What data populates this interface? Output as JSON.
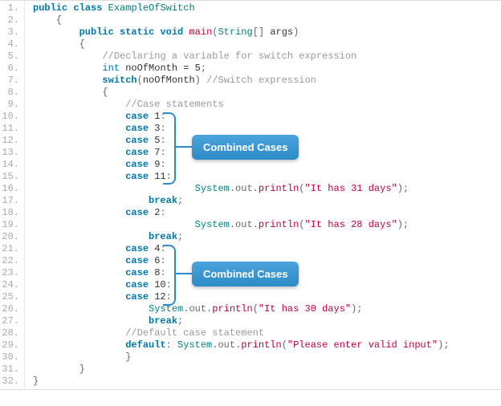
{
  "lines": [
    {
      "n": "1.",
      "tokens": [
        {
          "t": "public",
          "c": "kw"
        },
        {
          "t": " "
        },
        {
          "t": "class",
          "c": "kw"
        },
        {
          "t": " "
        },
        {
          "t": "ExampleOfSwitch",
          "c": "cls"
        }
      ],
      "indent": 0
    },
    {
      "n": "2.",
      "tokens": [
        {
          "t": "{",
          "c": "pun"
        }
      ],
      "indent": 1
    },
    {
      "n": "3.",
      "tokens": [
        {
          "t": "public",
          "c": "kw"
        },
        {
          "t": " "
        },
        {
          "t": "static",
          "c": "kw"
        },
        {
          "t": " "
        },
        {
          "t": "void",
          "c": "kw"
        },
        {
          "t": " "
        },
        {
          "t": "main",
          "c": "fn"
        },
        {
          "t": "(",
          "c": "pun"
        },
        {
          "t": "String",
          "c": "cls"
        },
        {
          "t": "[] ",
          "c": "pun"
        },
        {
          "t": "args",
          "c": "var"
        },
        {
          "t": ")",
          "c": "pun"
        }
      ],
      "indent": 2
    },
    {
      "n": "4.",
      "tokens": [
        {
          "t": "{",
          "c": "pun"
        }
      ],
      "indent": 2
    },
    {
      "n": "5.",
      "tokens": [
        {
          "t": "//Declaring a variable for switch expression",
          "c": "cmt"
        }
      ],
      "indent": 3
    },
    {
      "n": "6.",
      "tokens": [
        {
          "t": "int",
          "c": "type"
        },
        {
          "t": " noOfMonth = "
        },
        {
          "t": "5",
          "c": "num"
        },
        {
          "t": ";",
          "c": "pun"
        }
      ],
      "indent": 3
    },
    {
      "n": "7.",
      "tokens": [
        {
          "t": "switch",
          "c": "kw"
        },
        {
          "t": "(",
          "c": "pun"
        },
        {
          "t": "noOfMonth",
          "c": "var"
        },
        {
          "t": ")",
          "c": "pun"
        },
        {
          "t": " "
        },
        {
          "t": "//Switch expression",
          "c": "cmt"
        }
      ],
      "indent": 3
    },
    {
      "n": "8.",
      "tokens": [
        {
          "t": "{",
          "c": "pun"
        }
      ],
      "indent": 3
    },
    {
      "n": "9.",
      "tokens": [
        {
          "t": "//Case statements",
          "c": "cmt"
        }
      ],
      "indent": 4
    },
    {
      "n": "10.",
      "tokens": [
        {
          "t": "case",
          "c": "kw"
        },
        {
          "t": " "
        },
        {
          "t": "1",
          "c": "num"
        },
        {
          "t": ":",
          "c": "pun"
        }
      ],
      "indent": 4
    },
    {
      "n": "11.",
      "tokens": [
        {
          "t": "case",
          "c": "kw"
        },
        {
          "t": " "
        },
        {
          "t": "3",
          "c": "num"
        },
        {
          "t": ":",
          "c": "pun"
        }
      ],
      "indent": 4
    },
    {
      "n": "12.",
      "tokens": [
        {
          "t": "case",
          "c": "kw"
        },
        {
          "t": " "
        },
        {
          "t": "5",
          "c": "num"
        },
        {
          "t": ":",
          "c": "pun"
        }
      ],
      "indent": 4
    },
    {
      "n": "13.",
      "tokens": [
        {
          "t": "case",
          "c": "kw"
        },
        {
          "t": " "
        },
        {
          "t": "7",
          "c": "num"
        },
        {
          "t": ":",
          "c": "pun"
        }
      ],
      "indent": 4
    },
    {
      "n": "14.",
      "tokens": [
        {
          "t": "case",
          "c": "kw"
        },
        {
          "t": " "
        },
        {
          "t": "9",
          "c": "num"
        },
        {
          "t": ":",
          "c": "pun"
        }
      ],
      "indent": 4
    },
    {
      "n": "15.",
      "tokens": [
        {
          "t": "case",
          "c": "kw"
        },
        {
          "t": " "
        },
        {
          "t": "11",
          "c": "num"
        },
        {
          "t": ":",
          "c": "pun"
        }
      ],
      "indent": 4
    },
    {
      "n": "16.",
      "tokens": [
        {
          "t": "System",
          "c": "cls"
        },
        {
          "t": ".out.",
          "c": "pun"
        },
        {
          "t": "println",
          "c": "fn"
        },
        {
          "t": "(",
          "c": "pun"
        },
        {
          "t": "\"It has 31 days\"",
          "c": "str"
        },
        {
          "t": ");",
          "c": "pun"
        }
      ],
      "indent": 7
    },
    {
      "n": "17.",
      "tokens": [
        {
          "t": "break",
          "c": "kw"
        },
        {
          "t": ";",
          "c": "pun"
        }
      ],
      "indent": 5
    },
    {
      "n": "18.",
      "tokens": [
        {
          "t": "case",
          "c": "kw"
        },
        {
          "t": " "
        },
        {
          "t": "2",
          "c": "num"
        },
        {
          "t": ":",
          "c": "pun"
        }
      ],
      "indent": 4
    },
    {
      "n": "19.",
      "tokens": [
        {
          "t": "System",
          "c": "cls"
        },
        {
          "t": ".out.",
          "c": "pun"
        },
        {
          "t": "println",
          "c": "fn"
        },
        {
          "t": "(",
          "c": "pun"
        },
        {
          "t": "\"It has 28 days\"",
          "c": "str"
        },
        {
          "t": ");",
          "c": "pun"
        }
      ],
      "indent": 7
    },
    {
      "n": "20.",
      "tokens": [
        {
          "t": "break",
          "c": "kw"
        },
        {
          "t": ";",
          "c": "pun"
        }
      ],
      "indent": 5
    },
    {
      "n": "21.",
      "tokens": [
        {
          "t": "case",
          "c": "kw"
        },
        {
          "t": " "
        },
        {
          "t": "4",
          "c": "num"
        },
        {
          "t": ":",
          "c": "pun"
        }
      ],
      "indent": 4
    },
    {
      "n": "22.",
      "tokens": [
        {
          "t": "case",
          "c": "kw"
        },
        {
          "t": " "
        },
        {
          "t": "6",
          "c": "num"
        },
        {
          "t": ":",
          "c": "pun"
        }
      ],
      "indent": 4
    },
    {
      "n": "23.",
      "tokens": [
        {
          "t": "case",
          "c": "kw"
        },
        {
          "t": " "
        },
        {
          "t": "8",
          "c": "num"
        },
        {
          "t": ":",
          "c": "pun"
        }
      ],
      "indent": 4
    },
    {
      "n": "24.",
      "tokens": [
        {
          "t": "case",
          "c": "kw"
        },
        {
          "t": " "
        },
        {
          "t": "10",
          "c": "num"
        },
        {
          "t": ":",
          "c": "pun"
        }
      ],
      "indent": 4
    },
    {
      "n": "25.",
      "tokens": [
        {
          "t": "case",
          "c": "kw"
        },
        {
          "t": " "
        },
        {
          "t": "12",
          "c": "num"
        },
        {
          "t": ":",
          "c": "pun"
        }
      ],
      "indent": 4
    },
    {
      "n": "26.",
      "tokens": [
        {
          "t": "System",
          "c": "cls"
        },
        {
          "t": ".out.",
          "c": "pun"
        },
        {
          "t": "println",
          "c": "fn"
        },
        {
          "t": "(",
          "c": "pun"
        },
        {
          "t": "\"It has 30 days\"",
          "c": "str"
        },
        {
          "t": ");",
          "c": "pun"
        }
      ],
      "indent": 5
    },
    {
      "n": "27.",
      "tokens": [
        {
          "t": "break",
          "c": "kw"
        },
        {
          "t": ";",
          "c": "pun"
        }
      ],
      "indent": 5
    },
    {
      "n": "28.",
      "tokens": [
        {
          "t": "//Default case statement",
          "c": "cmt"
        }
      ],
      "indent": 4
    },
    {
      "n": "29.",
      "tokens": [
        {
          "t": "default",
          "c": "kw"
        },
        {
          "t": ": ",
          "c": "pun"
        },
        {
          "t": "System",
          "c": "cls"
        },
        {
          "t": ".out.",
          "c": "pun"
        },
        {
          "t": "println",
          "c": "fn"
        },
        {
          "t": "(",
          "c": "pun"
        },
        {
          "t": "\"Please enter valid input\"",
          "c": "str"
        },
        {
          "t": ");",
          "c": "pun"
        }
      ],
      "indent": 4
    },
    {
      "n": "30.",
      "tokens": [
        {
          "t": "}",
          "c": "pun"
        }
      ],
      "indent": 4
    },
    {
      "n": "31.",
      "tokens": [
        {
          "t": "}",
          "c": "pun"
        }
      ],
      "indent": 2
    },
    {
      "n": "32.",
      "tokens": [
        {
          "t": "}",
          "c": "pun"
        }
      ],
      "indent": 0
    }
  ],
  "annotations": {
    "label1": "Combined Cases",
    "label2": "Combined Cases"
  },
  "indent_unit": "    "
}
